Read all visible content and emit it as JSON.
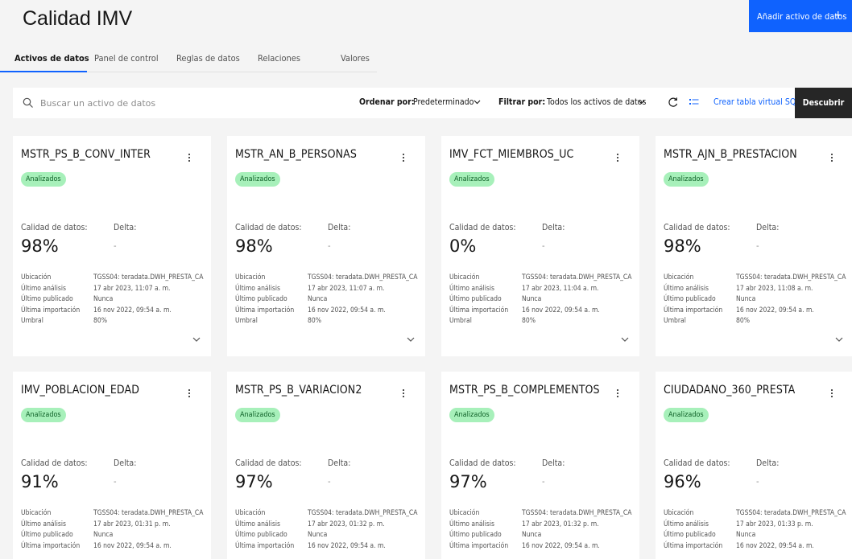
{
  "header": {
    "title": "Calidad IMV",
    "add_button": "Añadir activo de datos",
    "add_icon": "+"
  },
  "tabs": [
    {
      "label": "Activos de datos"
    },
    {
      "label": "Panel de control"
    },
    {
      "label": "Reglas de datos"
    },
    {
      "label": "Relaciones"
    },
    {
      "label": "Valores"
    }
  ],
  "toolbar": {
    "search_placeholder": "Buscar un activo de datos",
    "sort_label": "Ordenar por:",
    "sort_value": "Predeterminado",
    "filter_label": "Filtrar por:",
    "filter_value": "Todos los activos de datos",
    "refresh_icon": "refresh-icon",
    "columns_icon": "list-settings-icon",
    "create_link": "Crear tabla virtual SQL",
    "discover_button": "Descubrir"
  },
  "card_labels": {
    "quality": "Calidad de datos:",
    "delta": "Delta:",
    "location": "Ubicación",
    "last_analysis": "Último análisis",
    "last_published": "Último publicado",
    "last_import": "Última importación",
    "threshold": "Umbral"
  },
  "cards": [
    {
      "name": "MSTR_PS_B_CONV_INTER",
      "status": "Analizados",
      "quality": "98%",
      "delta": "-",
      "location": "TGSS04: teradata.DWH_PRESTA_CA",
      "last_analysis": "17 abr 2023, 11:07 a. m.",
      "last_published": "Nunca",
      "last_import": "16 nov 2022, 09:54 a. m.",
      "threshold": "80%"
    },
    {
      "name": "MSTR_AN_B_PERSONAS",
      "status": "Analizados",
      "quality": "98%",
      "delta": "-",
      "location": "TGSS04: teradata.DWH_PRESTA_CA",
      "last_analysis": "17 abr 2023, 11:07 a. m.",
      "last_published": "Nunca",
      "last_import": "16 nov 2022, 09:54 a. m.",
      "threshold": "80%"
    },
    {
      "name": "IMV_FCT_MIEMBROS_UC",
      "status": "Analizados",
      "quality": "0%",
      "delta": "-",
      "location": "TGSS04: teradata.DWH_PRESTA_CA",
      "last_analysis": "17 abr 2023, 11:04 a. m.",
      "last_published": "Nunca",
      "last_import": "16 nov 2022, 09:54 a. m.",
      "threshold": "80%"
    },
    {
      "name": "MSTR_AJN_B_PRESTACION",
      "status": "Analizados",
      "quality": "98%",
      "delta": "-",
      "location": "TGSS04: teradata.DWH_PRESTA_CA",
      "last_analysis": "17 abr 2023, 11:08 a. m.",
      "last_published": "Nunca",
      "last_import": "16 nov 2022, 09:54 a. m.",
      "threshold": "80%"
    },
    {
      "name": "IMV_POBLACION_EDAD",
      "status": "Analizados",
      "quality": "91%",
      "delta": "-",
      "location": "TGSS04: teradata.DWH_PRESTA_CA",
      "last_analysis": "17 abr 2023, 01:31 p. m.",
      "last_published": "Nunca",
      "last_import": "16 nov 2022, 09:54 a. m.",
      "threshold": ""
    },
    {
      "name": "MSTR_PS_B_VARIACION2",
      "status": "Analizados",
      "quality": "97%",
      "delta": "-",
      "location": "TGSS04: teradata.DWH_PRESTA_CA",
      "last_analysis": "17 abr 2023, 01:32 p. m.",
      "last_published": "Nunca",
      "last_import": "16 nov 2022, 09:54 a. m.",
      "threshold": ""
    },
    {
      "name": "MSTR_PS_B_COMPLEMENTOS",
      "status": "Analizados",
      "quality": "97%",
      "delta": "-",
      "location": "TGSS04: teradata.DWH_PRESTA_CA",
      "last_analysis": "17 abr 2023, 01:32 p. m.",
      "last_published": "Nunca",
      "last_import": "16 nov 2022, 09:54 a. m.",
      "threshold": ""
    },
    {
      "name": "CIUDADANO_360_PRESTA",
      "status": "Analizados",
      "quality": "96%",
      "delta": "-",
      "location": "TGSS04: teradata.DWH_PRESTA_CA",
      "last_analysis": "17 abr 2023, 01:33 p. m.",
      "last_published": "Nunca",
      "last_import": "16 nov 2022, 09:54 a. m.",
      "threshold": ""
    }
  ],
  "colors": {
    "accent": "#0f62fe",
    "badge_bg": "#a7f0ba",
    "badge_text": "#0e6027",
    "dark_button": "#262626"
  }
}
